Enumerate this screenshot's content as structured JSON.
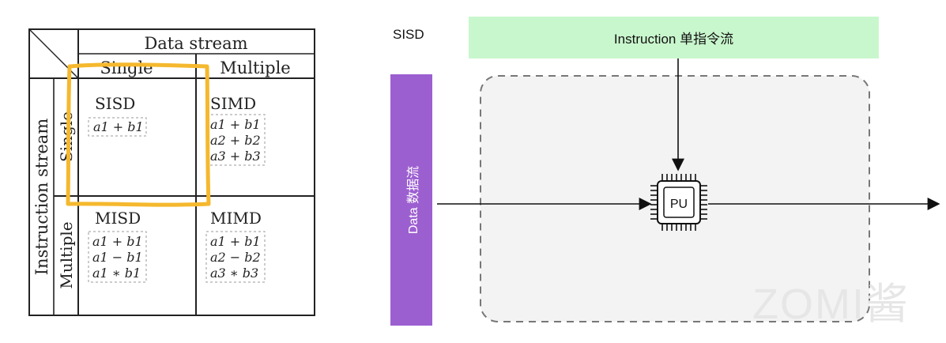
{
  "flynn_table": {
    "col_group_header": "Data stream",
    "col_single": "Single",
    "col_multiple": "Multiple",
    "row_group_header": "Instruction stream",
    "row_single": "Single",
    "row_multiple": "Multiple",
    "cells": {
      "sisd": {
        "title": "SISD",
        "ops": [
          "a1 + b1"
        ]
      },
      "simd": {
        "title": "SIMD",
        "ops": [
          "a1 + b1",
          "a2 + b2",
          "a3 + b3"
        ]
      },
      "misd": {
        "title": "MISD",
        "ops": [
          "a1 + b1",
          "a1 − b1",
          "a1 ∗ b1"
        ]
      },
      "mimd": {
        "title": "MIMD",
        "ops": [
          "a1 + b1",
          "a2 − b2",
          "a3 ∗ b3"
        ]
      }
    },
    "highlight_color": "#f5b82e"
  },
  "sisd_diagram": {
    "label": "SISD",
    "instruction_stream": "Instruction 单指令流",
    "data_stream": "Data 数据流",
    "processor": "PU",
    "colors": {
      "instruction_bar": "#c9f7cd",
      "data_bar": "#9c5fd0",
      "container": "#f3f3f3"
    },
    "icon": "cpu-chip-icon"
  },
  "watermark": "ZOMI酱"
}
